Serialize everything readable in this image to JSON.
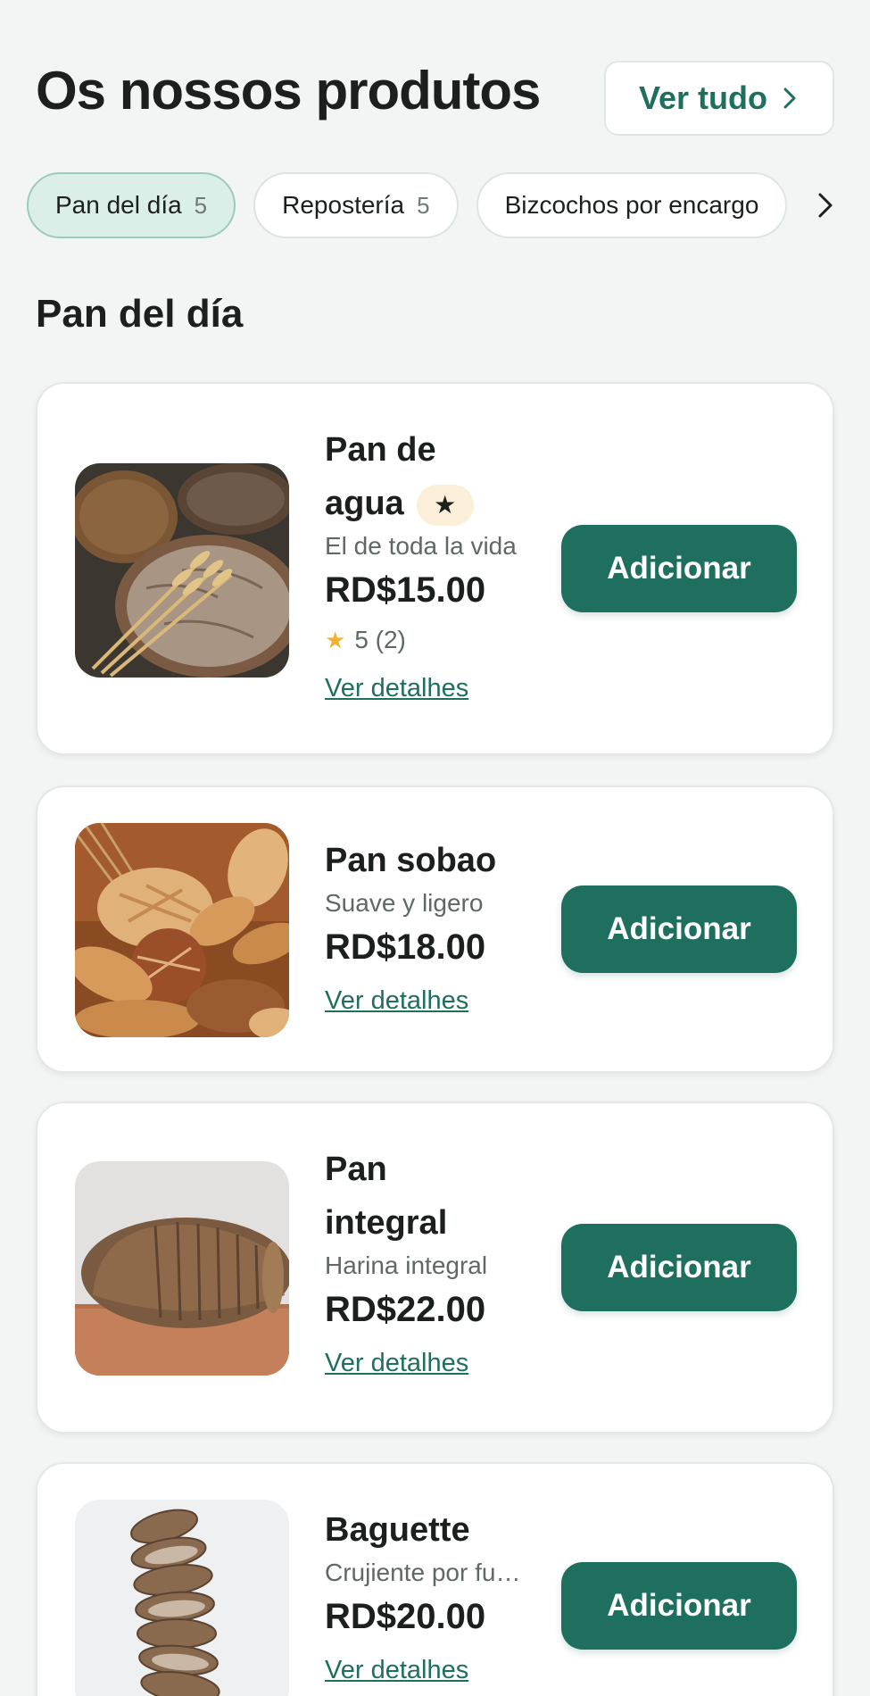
{
  "header": {
    "title": "Os nossos produtos",
    "view_all_label": "Ver tudo"
  },
  "categories": [
    {
      "label": "Pan del día",
      "count": "5",
      "active": true
    },
    {
      "label": "Repostería",
      "count": "5",
      "active": false
    },
    {
      "label": "Bizcochos por encargo",
      "count": "",
      "active": false
    }
  ],
  "section": {
    "title": "Pan del día"
  },
  "products": [
    {
      "name_line1": "Pan de",
      "name_line2": "agua",
      "featured_icon": "★",
      "description": "El de toda la vida",
      "price": "RD$15.00",
      "rating_star": "★",
      "rating_text": "5 (2)",
      "details_label": "Ver detalhes",
      "add_label": "Adicionar"
    },
    {
      "name_line1": "Pan sobao",
      "description": "Suave y ligero",
      "price": "RD$18.00",
      "details_label": "Ver detalhes",
      "add_label": "Adicionar"
    },
    {
      "name_line1": "Pan",
      "name_line2": "integral",
      "description": "Harina integral",
      "price": "RD$22.00",
      "details_label": "Ver detalhes",
      "add_label": "Adicionar"
    },
    {
      "name_line1": "Baguette",
      "description": "Crujiente por fuera",
      "price": "RD$20.00",
      "details_label": "Ver detalhes",
      "add_label": "Adicionar"
    }
  ],
  "colors": {
    "accent": "#1f6f5f",
    "background": "#f3f5f4",
    "active_chip": "#dceee8",
    "star": "#f0b331"
  },
  "icons": {
    "view_all": "chevron-right-icon",
    "chips_next": "chevron-right-icon",
    "featured": "star-icon",
    "rating": "star-icon"
  }
}
